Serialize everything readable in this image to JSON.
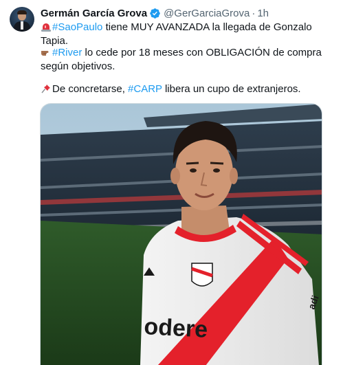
{
  "tweet": {
    "author_name": "Germán García Grova",
    "handle": "@GerGarciaGrova",
    "separator": "·",
    "time": "1h",
    "line1": {
      "hashtag": "#SaoPaulo",
      "text": " tiene MUY AVANZADA la llegada de Gonzalo Tapia."
    },
    "line2": {
      "hashtag": "#River",
      "text": " lo cede por 18 meses con OBLIGACIÓN de compra según objetivos."
    },
    "line3": {
      "text_before": "De concretarse, ",
      "hashtag": "#CARP",
      "text_after": " libera un cupo de extranjeros."
    },
    "image": {
      "jersey_sponsor": "odere",
      "brand_mark": "adi"
    }
  },
  "icons": {
    "line1": "siren-icon",
    "line2": "pointing-hand-icon",
    "line3": "pushpin-icon",
    "verified": "verified-badge-icon"
  },
  "colors": {
    "link": "#1d9bf0",
    "verified": "#1d9bf0",
    "secondary_text": "#536471",
    "jersey_band": "#e4212b"
  }
}
